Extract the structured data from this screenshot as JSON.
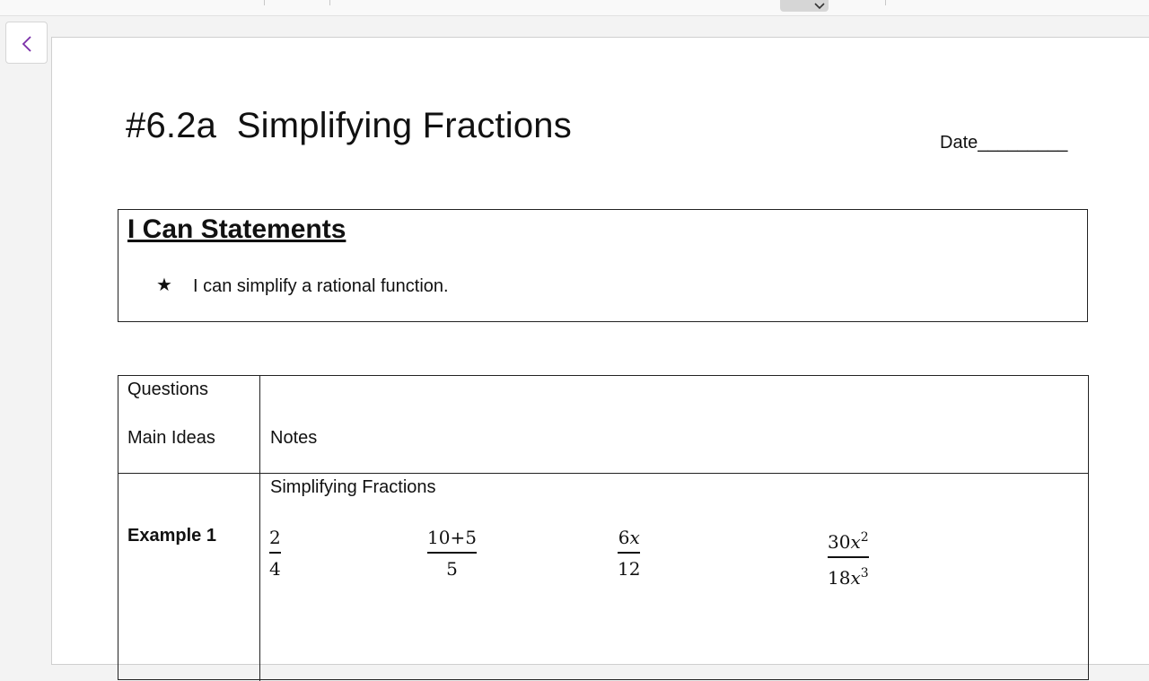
{
  "document": {
    "title": "#6.2a  Simplifying Fractions",
    "date_label": "Date_________"
  },
  "i_can": {
    "heading": "I Can Statements",
    "bullet_icon": "star-icon",
    "items": [
      "I can simplify a rational function."
    ]
  },
  "notes_table": {
    "header_left_line1": "Questions",
    "header_left_line2": "Main Ideas",
    "header_right": "Notes",
    "example_label": "Example 1",
    "section_title": "Simplifying Fractions",
    "fractions": [
      {
        "numerator": "2",
        "denominator": "4"
      },
      {
        "numerator": "10+5",
        "denominator": "5"
      },
      {
        "numerator_coef": "6",
        "numerator_var": "x",
        "denominator": "12"
      },
      {
        "numerator_coef": "30",
        "numerator_var": "x",
        "numerator_exp": "2",
        "denominator_coef": "18",
        "denominator_var": "x",
        "denominator_exp": "3"
      }
    ]
  },
  "icons": {
    "back": "chevron-left-icon",
    "dropdown": "chevron-down-icon"
  },
  "colors": {
    "back_chevron": "#7a2ea8",
    "page_background": "#ffffff",
    "app_background": "#f3f3f3"
  }
}
